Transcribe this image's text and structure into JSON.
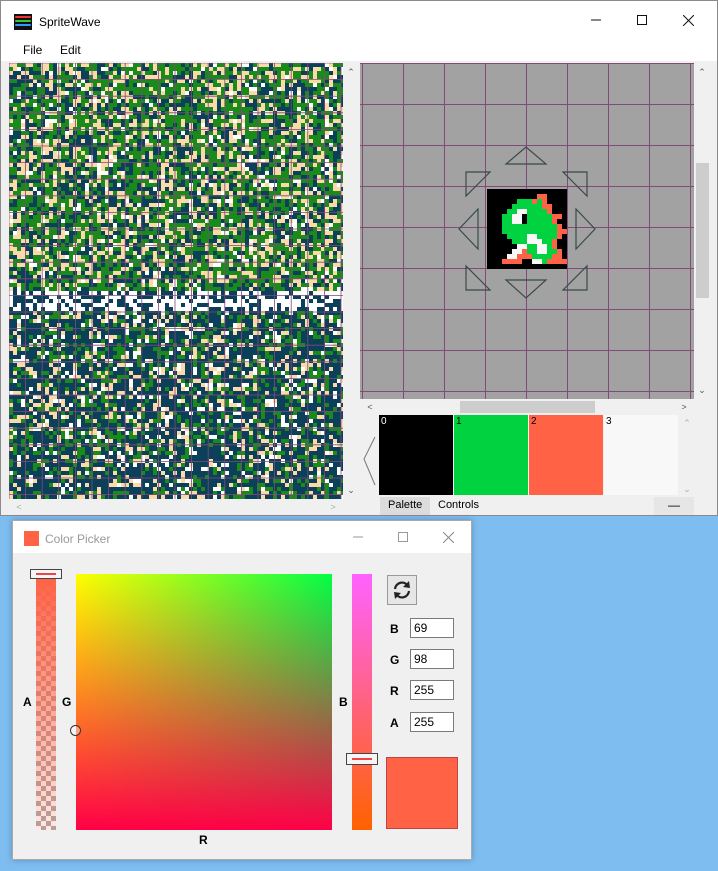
{
  "main_window": {
    "title": "SpriteWave",
    "menu": [
      "File",
      "Edit"
    ],
    "palette": {
      "swatches": [
        {
          "index": "0",
          "color": "#000000"
        },
        {
          "index": "1",
          "color": "#00d240"
        },
        {
          "index": "2",
          "color": "#ff6245"
        },
        {
          "index": "3",
          "color": "#f8f8f8"
        }
      ]
    },
    "tabs": [
      "Palette",
      "Controls"
    ],
    "tile_colors": [
      "#0c3f5a",
      "#1a8a1a",
      "#fcd9a8",
      "#ffffff",
      "#0a7a0a"
    ]
  },
  "color_picker": {
    "title": "Color Picker",
    "axis_labels": {
      "alpha": "A",
      "green": "G",
      "red": "R",
      "blue": "B"
    },
    "fields": [
      {
        "label": "B",
        "value": "69"
      },
      {
        "label": "G",
        "value": "98"
      },
      {
        "label": "R",
        "value": "255"
      },
      {
        "label": "A",
        "value": "255"
      }
    ],
    "selected_color": "#ff6245"
  }
}
